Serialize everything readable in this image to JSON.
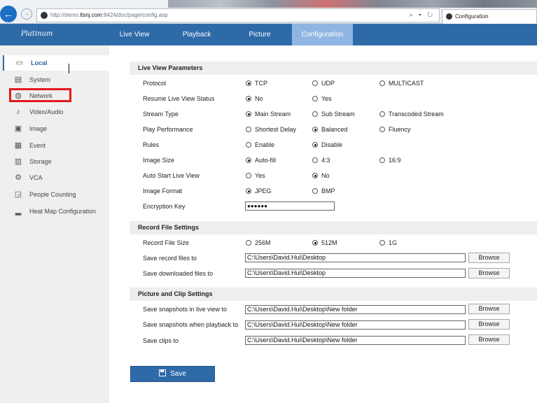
{
  "browser": {
    "url_prefix": "http://demo.",
    "url_host": "ltsnj.com",
    "url_rest": ":8424/doc/page/config.asp",
    "url_tools": "⌕ ▾ ↻",
    "tab_title": "Configuration"
  },
  "header": {
    "brand": "Platinum",
    "menu": [
      "Live View",
      "Playback",
      "Picture",
      "Configuration"
    ],
    "active_menu": "Configuration"
  },
  "sidebar": {
    "items": [
      {
        "label": "Local",
        "icon": "monitor-icon",
        "glyph": "▭"
      },
      {
        "label": "System",
        "icon": "system-icon",
        "glyph": "▤"
      },
      {
        "label": "Network",
        "icon": "globe-icon",
        "glyph": "◍"
      },
      {
        "label": "Video/Audio",
        "icon": "microphone-icon",
        "glyph": "♪"
      },
      {
        "label": "Image",
        "icon": "image-icon",
        "glyph": "▣"
      },
      {
        "label": "Event",
        "icon": "calendar-icon",
        "glyph": "▦"
      },
      {
        "label": "Storage",
        "icon": "storage-icon",
        "glyph": "▥"
      },
      {
        "label": "VCA",
        "icon": "vca-icon",
        "glyph": "⚙"
      },
      {
        "label": "People Counting",
        "icon": "people-counting-icon",
        "glyph": "◲"
      },
      {
        "label": "Heat Map Configuration",
        "icon": "bar-chart-icon",
        "glyph": "▂"
      }
    ],
    "active": "Local",
    "highlighted": "Network"
  },
  "live_view": {
    "title": "Live View Parameters",
    "protocol": {
      "label": "Protocol",
      "options": [
        "TCP",
        "UDP",
        "MULTICAST"
      ],
      "selected": "TCP"
    },
    "resume": {
      "label": "Resume Live View Status",
      "options": [
        "No",
        "Yes"
      ],
      "selected": "No"
    },
    "stream_type": {
      "label": "Stream Type",
      "options": [
        "Main Stream",
        "Sub Stream",
        "Transcoded Stream"
      ],
      "selected": "Main Stream"
    },
    "play_performance": {
      "label": "Play Performance",
      "options": [
        "Shortest Delay",
        "Balanced",
        "Fluency"
      ],
      "selected": "Balanced"
    },
    "rules": {
      "label": "Rules",
      "options": [
        "Enable",
        "Disable"
      ],
      "selected": "Disable"
    },
    "image_size": {
      "label": "Image Size",
      "options": [
        "Auto-fill",
        "4:3",
        "16:9"
      ],
      "selected": "Auto-fill"
    },
    "auto_start": {
      "label": "Auto Start Live View",
      "options": [
        "Yes",
        "No"
      ],
      "selected": "No"
    },
    "image_format": {
      "label": "Image Format",
      "options": [
        "JPEG",
        "BMP"
      ],
      "selected": "JPEG"
    },
    "encryption_key": {
      "label": "Encryption Key",
      "value": "●●●●●●"
    }
  },
  "record": {
    "title": "Record File Settings",
    "file_size": {
      "label": "Record File Size",
      "options": [
        "256M",
        "512M",
        "1G"
      ],
      "selected": "512M"
    },
    "save_record": {
      "label": "Save record files to",
      "value": "C:\\Users\\David.Hui\\Desktop"
    },
    "save_downloaded": {
      "label": "Save downloaded files to",
      "value": "C:\\Users\\David.Hui\\Desktop"
    }
  },
  "picture_clip": {
    "title": "Picture and Clip Settings",
    "snap_live": {
      "label": "Save snapshots in live view to",
      "value": "C:\\Users\\David.Hui\\Desktop\\New folder"
    },
    "snap_playback": {
      "label": "Save snapshots when playback to",
      "value": "C:\\Users\\David.Hui\\Desktop\\New folder"
    },
    "clips": {
      "label": "Save clips to",
      "value": "C:\\Users\\David.Hui\\Desktop\\New folder"
    }
  },
  "browse_label": "Browse",
  "save_label": "Save",
  "colors": {
    "accent": "#2f6aa8",
    "highlight": "#e2191e",
    "active_tab": "#8fb6e2"
  }
}
